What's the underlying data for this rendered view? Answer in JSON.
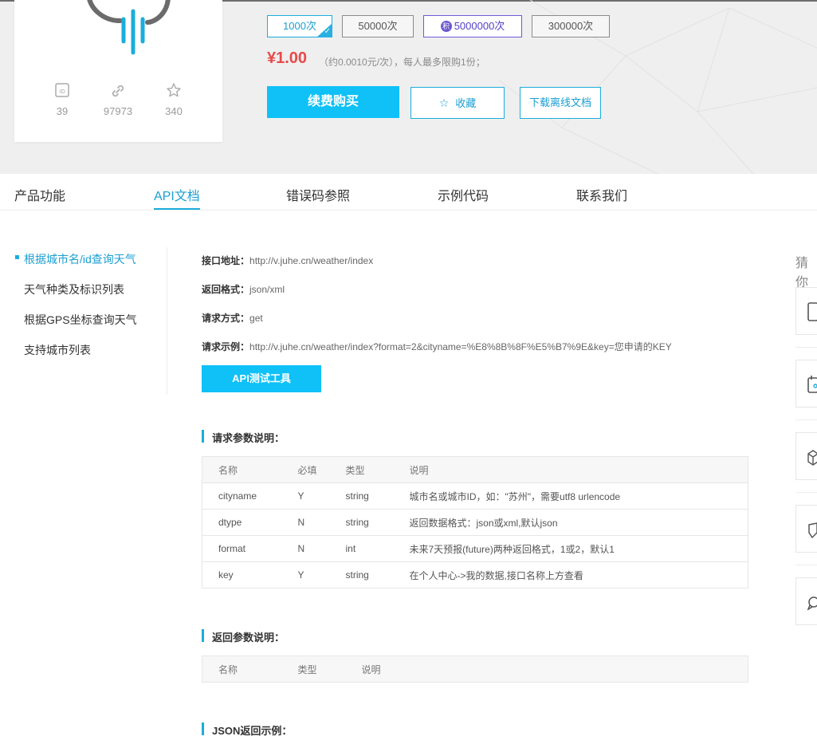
{
  "stats": [
    {
      "icon": "id-icon",
      "value": "39"
    },
    {
      "icon": "link-icon",
      "value": "97973"
    },
    {
      "icon": "star-icon",
      "value": "340"
    }
  ],
  "packages": [
    {
      "label": "1000次",
      "state": "selected"
    },
    {
      "label": "50000次",
      "state": "normal"
    },
    {
      "label": "5000000次",
      "state": "points",
      "badge": "积"
    },
    {
      "label": "300000次",
      "state": "normal"
    }
  ],
  "price": {
    "value": "¥1.00",
    "note": "（约0.0010元/次），每人最多限购1份；"
  },
  "actions": {
    "buy": "续费购买",
    "favorite": "收藏",
    "download": "下载离线文档"
  },
  "tabs": [
    "产品功能",
    "API文档",
    "错误码参照",
    "示例代码",
    "联系我们"
  ],
  "active_tab": "API文档",
  "sidebar": {
    "items": [
      "根据城市名/id查询天气",
      "天气种类及标识列表",
      "根据GPS坐标查询天气",
      "支持城市列表"
    ]
  },
  "api": {
    "url_label": "接口地址：",
    "url": "http://v.juhe.cn/weather/index",
    "format_label": "返回格式：",
    "format": "json/xml",
    "method_label": "请求方式：",
    "method": "get",
    "example_label": "请求示例：",
    "example": "http://v.juhe.cn/weather/index?format=2&cityname=%E8%8B%8F%E5%B7%9E&key=您申请的KEY",
    "test_button": "API测试工具"
  },
  "request_params": {
    "title": "请求参数说明：",
    "headers": [
      "名称",
      "必填",
      "类型",
      "说明"
    ],
    "rows": [
      [
        "cityname",
        "Y",
        "string",
        "城市名或城市ID，如：\"苏州\"，需要utf8 urlencode"
      ],
      [
        "dtype",
        "N",
        "string",
        "返回数据格式：json或xml,默认json"
      ],
      [
        "format",
        "N",
        "int",
        "未来7天预报(future)两种返回格式，1或2，默认1"
      ],
      [
        "key",
        "Y",
        "string",
        "在个人中心->我的数据,接口名称上方查看"
      ]
    ]
  },
  "response_params": {
    "title": "返回参数说明：",
    "headers": [
      "名称",
      "类型",
      "说明"
    ]
  },
  "json_example": {
    "title": "JSON返回示例："
  },
  "right": {
    "guess": "猜你"
  },
  "colors": {
    "accent": "#0fc1f7",
    "link": "#1b9fd2",
    "price": "#e84a4a",
    "points": "#6a57cf"
  }
}
